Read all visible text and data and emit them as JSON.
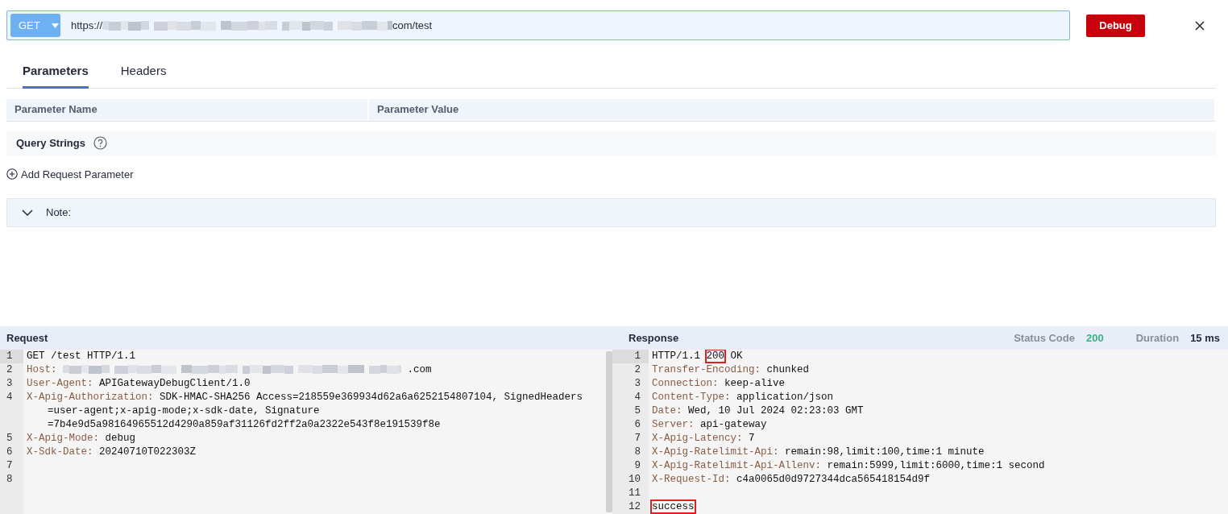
{
  "request_bar": {
    "method": "GET",
    "url": [
      {
        "kind": "text",
        "text": "https://"
      },
      {
        "kind": "redacted"
      },
      {
        "kind": "text",
        "text": "com/test"
      }
    ]
  },
  "debug_button": "Debug",
  "tabs": [
    {
      "label": "Parameters",
      "selected": true
    },
    {
      "label": "Headers",
      "selected": false
    }
  ],
  "parameter_table": {
    "columns": [
      "Parameter Name",
      "Parameter Value"
    ],
    "section": "Query Strings"
  },
  "add_parameter": "Add Request Parameter",
  "note": {
    "label": "Note:",
    "expanded": false
  },
  "request": {
    "title": "Request",
    "lines": [
      {
        "number": "1",
        "parts": [
          {
            "kind": "value",
            "text": "GET /test HTTP/1.1"
          }
        ]
      },
      {
        "number": "2",
        "parts": [
          {
            "kind": "key",
            "text": "Host:"
          },
          {
            "kind": "redacted"
          },
          {
            "kind": "value",
            "text": ".com"
          }
        ]
      },
      {
        "number": "3",
        "parts": [
          {
            "kind": "key",
            "text": "User-Agent:"
          },
          {
            "kind": "value",
            "text": "APIGatewayDebugClient/1.0"
          }
        ]
      },
      {
        "number": "4",
        "parts": [
          {
            "kind": "key",
            "text": "X-Apig-Authorization:"
          },
          {
            "kind": "value",
            "text": "SDK-HMAC-SHA256 Access=218559e369934d62a6a6252154807104, SignedHeaders"
          }
        ],
        "continued": [
          "=user-agent;x-apig-mode;x-sdk-date, Signature",
          "=7b4e9d5a98164965512d4290a859af31126fd2ff2a0a2322e543f8e191539f8e"
        ]
      },
      {
        "number": "5",
        "parts": [
          {
            "kind": "key",
            "text": "X-Apig-Mode:"
          },
          {
            "kind": "value",
            "text": "debug"
          }
        ]
      },
      {
        "number": "6",
        "parts": [
          {
            "kind": "key",
            "text": "X-Sdk-Date:"
          },
          {
            "kind": "value",
            "text": "20240710T022303Z"
          }
        ]
      },
      {
        "number": "7"
      },
      {
        "number": "8"
      }
    ]
  },
  "response": {
    "title": "Response",
    "status_label": "Status Code",
    "status_code": "200",
    "duration_label": "Duration",
    "duration": "15 ms",
    "lines": [
      {
        "number": "1",
        "parts": [
          {
            "kind": "value",
            "text": "HTTP/1.1"
          },
          {
            "kind": "value",
            "text": "200",
            "highlighted": true
          },
          {
            "kind": "value",
            "text": "OK"
          }
        ]
      },
      {
        "number": "2",
        "parts": [
          {
            "kind": "key",
            "text": "Transfer-Encoding:"
          },
          {
            "kind": "value",
            "text": "chunked"
          }
        ]
      },
      {
        "number": "3",
        "parts": [
          {
            "kind": "key",
            "text": "Connection:"
          },
          {
            "kind": "value",
            "text": "keep-alive"
          }
        ]
      },
      {
        "number": "4",
        "parts": [
          {
            "kind": "key",
            "text": "Content-Type:"
          },
          {
            "kind": "value",
            "text": "application/json"
          }
        ]
      },
      {
        "number": "5",
        "parts": [
          {
            "kind": "key",
            "text": "Date:"
          },
          {
            "kind": "value",
            "text": "Wed, 10 Jul 2024 02:23:03 GMT"
          }
        ]
      },
      {
        "number": "6",
        "parts": [
          {
            "kind": "key",
            "text": "Server:"
          },
          {
            "kind": "value",
            "text": "api-gateway"
          }
        ]
      },
      {
        "number": "7",
        "parts": [
          {
            "kind": "key",
            "text": "X-Apig-Latency:"
          },
          {
            "kind": "value",
            "text": "7"
          }
        ]
      },
      {
        "number": "8",
        "parts": [
          {
            "kind": "key",
            "text": "X-Apig-Ratelimit-Api:"
          },
          {
            "kind": "value",
            "text": "remain:98,limit:100,time:1 minute"
          }
        ]
      },
      {
        "number": "9",
        "parts": [
          {
            "kind": "key",
            "text": "X-Apig-Ratelimit-Api-Allenv:"
          },
          {
            "kind": "value",
            "text": "remain:5999,limit:6000,time:1 second"
          }
        ]
      },
      {
        "number": "10",
        "parts": [
          {
            "kind": "key",
            "text": "X-Request-Id:"
          },
          {
            "kind": "value",
            "text": "c4a0065d0d9727344dca565418154d9f"
          }
        ]
      },
      {
        "number": "11"
      },
      {
        "number": "12",
        "parts": [
          {
            "kind": "value",
            "text": "success",
            "highlighted": true
          }
        ]
      }
    ]
  }
}
